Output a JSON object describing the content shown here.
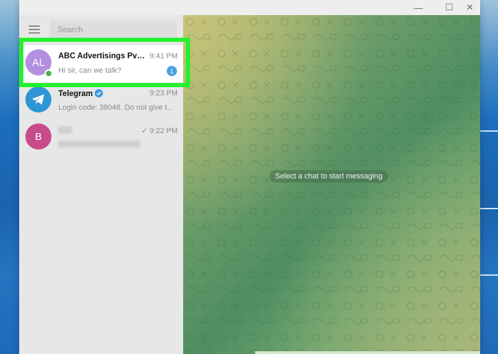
{
  "window": {
    "controls": {
      "minimize": "—",
      "maximize": "☐",
      "close": "✕"
    }
  },
  "sidebar": {
    "search": {
      "placeholder": "Search",
      "value": ""
    },
    "chats": [
      {
        "initials": "AL",
        "name": "ABC Advertisings Pvt. L...",
        "time": "9:41 PM",
        "preview": "Hi sir, can we talk?",
        "unread": "1",
        "avatar_color": "#b48fe0",
        "online": true,
        "active": true
      },
      {
        "name": "Telegram",
        "verified": true,
        "time": "9:23 PM",
        "preview": "Login code: 38048. Do not give t...",
        "avatar_color": "#2f96d6",
        "avatar_icon": "telegram-plane-icon"
      },
      {
        "initials": "B",
        "name": "",
        "time": "9:22 PM",
        "preview": "",
        "avatar_color": "#c84b8a",
        "sent_check": true,
        "name_blurred": true,
        "preview_blurred": true
      }
    ]
  },
  "chat_area": {
    "empty_message": "Select a chat to start messaging"
  },
  "colors": {
    "highlight": "#22f22e",
    "accent": "#4aa3df",
    "online": "#4bb34b"
  }
}
